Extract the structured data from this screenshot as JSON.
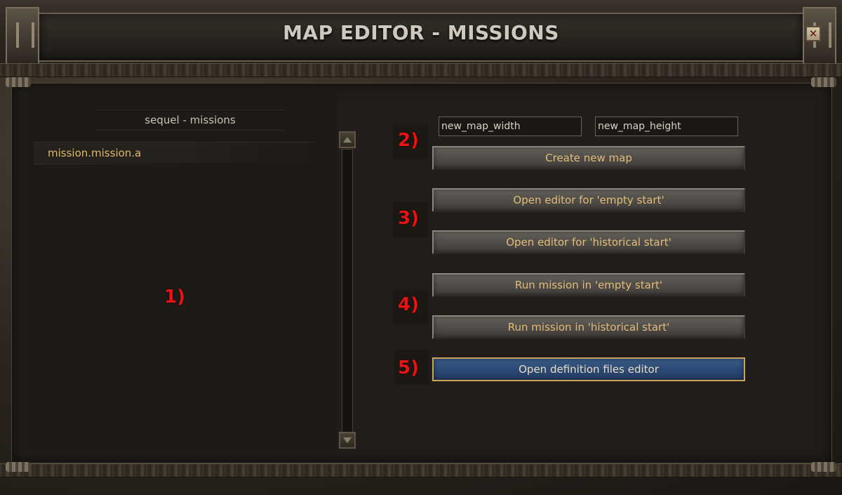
{
  "window": {
    "title": "MAP EDITOR - MISSIONS",
    "close_label": "✕"
  },
  "missions_list": {
    "header": "sequel - missions",
    "items": [
      "mission.mission.a"
    ]
  },
  "annotations": [
    "1)",
    "2)",
    "3)",
    "4)",
    "5)"
  ],
  "new_map": {
    "width_placeholder": "new_map_width",
    "height_placeholder": "new_map_height"
  },
  "buttons": {
    "create_new_map": "Create new map",
    "open_editor_empty": "Open editor for 'empty start'",
    "open_editor_historical": "Open editor for 'historical start'",
    "run_mission_empty": "Run mission in 'empty start'",
    "run_mission_historical": "Run mission in 'historical start'",
    "open_definition_editor": "Open definition files editor"
  },
  "colors": {
    "button_text": "#e2bd79",
    "selected_button": "#2d4b76",
    "annotation": "#e81313",
    "list_item": "#e0b86a"
  }
}
